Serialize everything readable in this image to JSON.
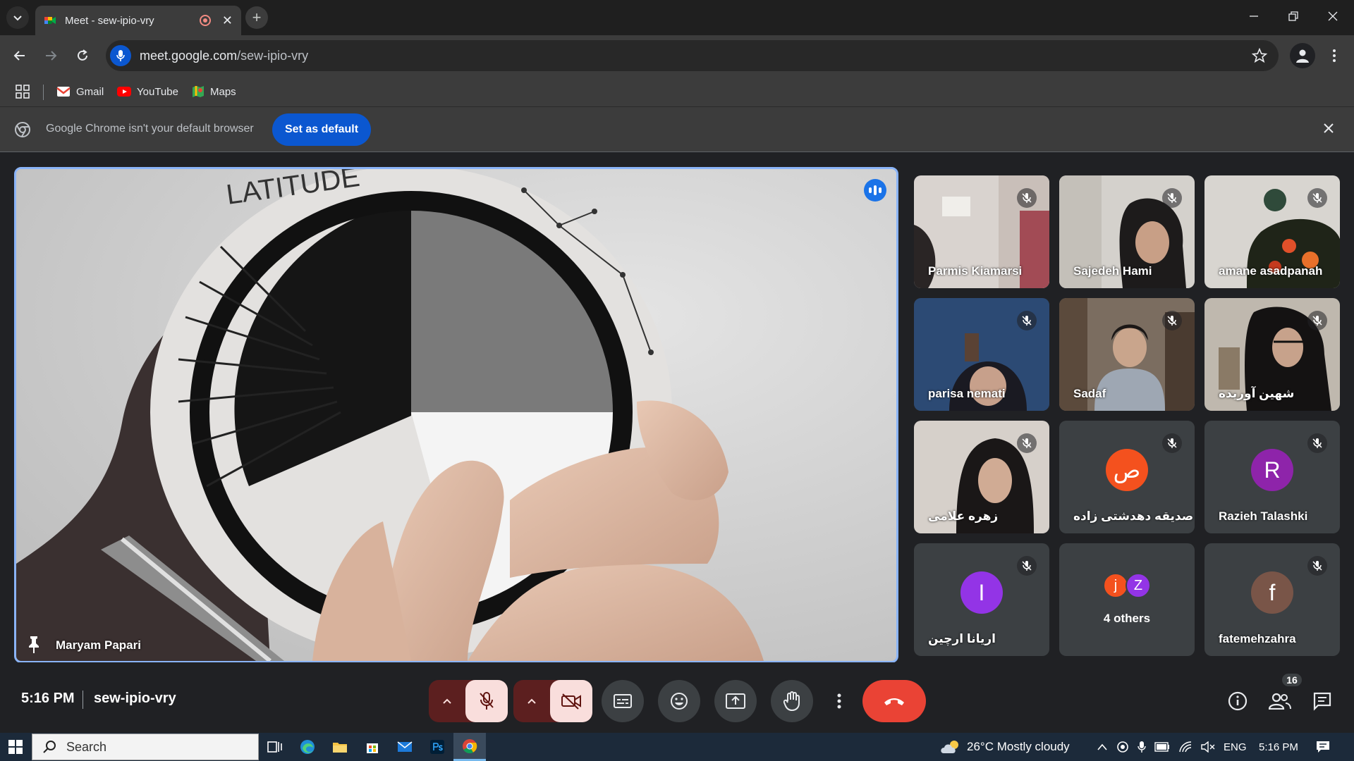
{
  "browser": {
    "tab_title": "Meet - sew-ipio-vry",
    "url_host": "meet.google.com",
    "url_path": "/sew-ipio-vry",
    "bookmarks": [
      {
        "label": "Gmail",
        "icon": "gmail-icon"
      },
      {
        "label": "YouTube",
        "icon": "youtube-icon"
      },
      {
        "label": "Maps",
        "icon": "maps-icon"
      }
    ]
  },
  "infobar": {
    "message": "Google Chrome isn't your default browser",
    "button": "Set as default"
  },
  "meeting": {
    "pinned": {
      "name": "Maryam Papari",
      "disc_label": "LATITUDE"
    },
    "tiles": [
      {
        "name": "Parmis Kiamarsi",
        "kind": "video",
        "muted": true
      },
      {
        "name": "Sajedeh Hami",
        "kind": "video",
        "muted": true
      },
      {
        "name": "amane asadpanah",
        "kind": "video",
        "muted": true
      },
      {
        "name": "parisa nemati",
        "kind": "video",
        "muted": true
      },
      {
        "name": "Sadaf",
        "kind": "video",
        "muted": true
      },
      {
        "name": "شهین آوریده",
        "kind": "video",
        "muted": true
      },
      {
        "name": "زهره علامی",
        "kind": "video",
        "muted": true
      },
      {
        "name": "صدیقه دهدشتی زاده",
        "kind": "avatar",
        "initial": "ص",
        "color": "#f4511e",
        "muted": true
      },
      {
        "name": "Razieh Talashki",
        "kind": "avatar",
        "initial": "R",
        "color": "#8e24aa",
        "muted": true
      },
      {
        "name": "اریانا ارچین",
        "kind": "avatar",
        "initial": "I",
        "color": "#9334e6",
        "muted": true
      },
      {
        "name": "4 others",
        "kind": "others",
        "initials": [
          "j",
          "Z"
        ],
        "colors": [
          "#f4511e",
          "#9334e6"
        ]
      },
      {
        "name": "fatemehzahra",
        "kind": "avatar",
        "initial": "f",
        "color": "#795548",
        "muted": true
      }
    ],
    "time": "5:16 PM",
    "code": "sew-ipio-vry",
    "participant_count": "16"
  },
  "taskbar": {
    "search_label": "Search",
    "weather": "26°C  Mostly cloudy",
    "language": "ENG",
    "clock": "5:16 PM"
  },
  "colors": {
    "accent": "#8ab4f8",
    "hangup": "#ea4335",
    "muted_bg": "#f9dedc"
  }
}
